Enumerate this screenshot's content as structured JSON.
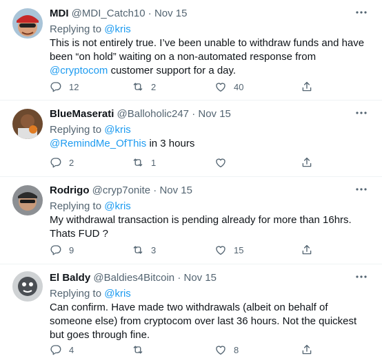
{
  "reply_prefix": "Replying to ",
  "tweets": [
    {
      "name": "MDI",
      "handle": "@MDI_Catch10",
      "date": "Nov 15",
      "replying_to": "@kris",
      "body_parts": [
        "This is not entirely true. I’ve been unable to withdraw funds and have been “on hold” waiting on a non-automated response from ",
        "@cryptocom",
        " customer support for a day."
      ],
      "replies": "12",
      "retweets": "2",
      "likes": "40"
    },
    {
      "name": "BlueMaserati",
      "handle": "@Balloholic247",
      "date": "Nov 15",
      "replying_to": "@kris",
      "body_parts": [
        "",
        "@RemindMe_OfThis",
        " in 3 hours"
      ],
      "replies": "2",
      "retweets": "1",
      "likes": ""
    },
    {
      "name": "Rodrigo",
      "handle": "@cryp7onite",
      "date": "Nov 15",
      "replying_to": "@kris",
      "body_parts": [
        "My withdrawal transaction is pending already for more than 16hrs. Thats FUD ?",
        "",
        ""
      ],
      "replies": "9",
      "retweets": "3",
      "likes": "15"
    },
    {
      "name": "El Baldy",
      "handle": "@Baldies4Bitcoin",
      "date": "Nov 15",
      "replying_to": "@kris",
      "body_parts": [
        "Can confirm. Have made two withdrawals (albeit on behalf of someone else) from cryptocom over last 36 hours. Not the quickest but goes through fine.",
        "",
        ""
      ],
      "replies": "4",
      "retweets": "",
      "likes": "8"
    }
  ],
  "icons": {
    "reply": "reply-icon",
    "retweet": "retweet-icon",
    "like": "heart-icon",
    "share": "share-icon",
    "more": "more-icon"
  },
  "colors": {
    "link": "#1d9bf0",
    "secondary": "#536471",
    "text": "#0f1419"
  }
}
